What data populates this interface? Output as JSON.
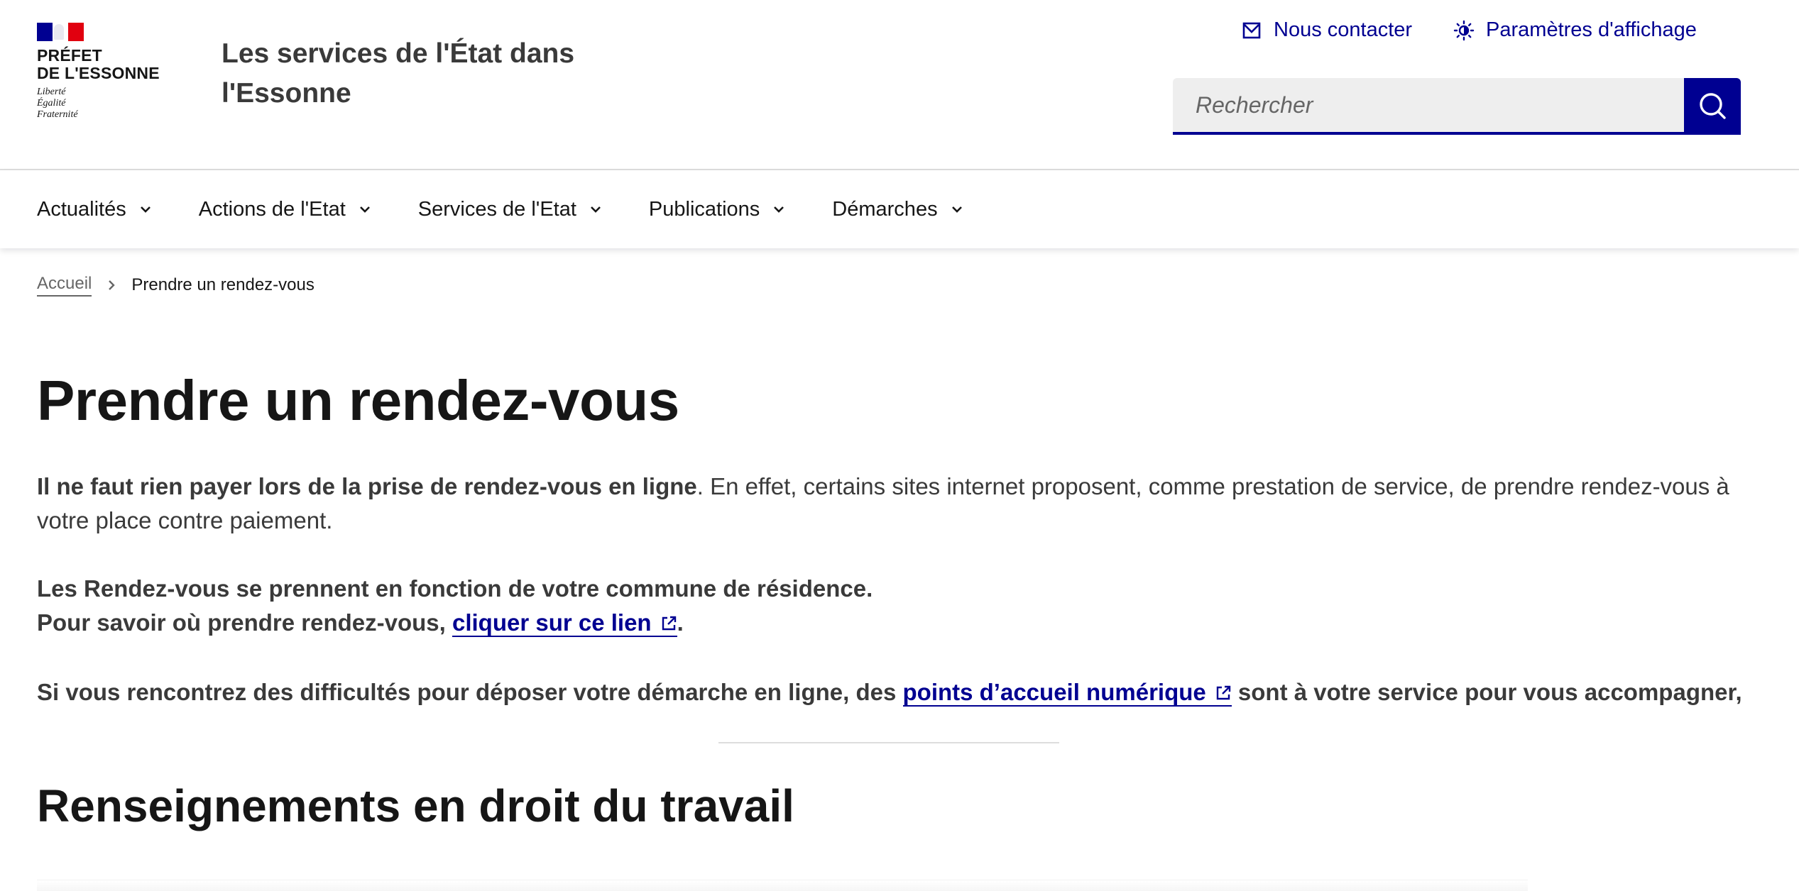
{
  "header": {
    "logo": {
      "name_line1": "PRÉFET",
      "name_line2": "DE L'ESSONNE",
      "motto": [
        "Liberté",
        "Égalité",
        "Fraternité"
      ],
      "flag_colors": {
        "blue": "#000091",
        "white": "#ffffff",
        "red": "#e1000f"
      }
    },
    "site_title": "Les services de l'État dans l'Essonne",
    "tools": {
      "contact_label": "Nous contacter",
      "contact_icon": "mail-icon",
      "display_label": "Paramètres d'affichage",
      "display_icon": "sun-contrast-icon"
    },
    "search": {
      "placeholder": "Rechercher",
      "value": "",
      "button_icon": "search-icon",
      "button_label": "Rechercher"
    }
  },
  "nav": {
    "items": [
      {
        "label": "Actualités"
      },
      {
        "label": "Actions de l'Etat"
      },
      {
        "label": "Services de l'Etat"
      },
      {
        "label": "Publications"
      },
      {
        "label": "Démarches"
      }
    ]
  },
  "breadcrumb": {
    "home": "Accueil",
    "current": "Prendre un rendez-vous"
  },
  "main": {
    "title": "Prendre un rendez-vous",
    "p1_bold": "Il ne faut rien payer lors de la prise de rendez-vous en ligne",
    "p1_rest": ". En effet, certains sites internet proposent, comme prestation de service, de prendre rendez-vous à votre place contre paiement.",
    "p2_line1": "Les Rendez-vous se prennent en fonction de votre commune de résidence.",
    "p2_line2_prefix": "Pour savoir où prendre rendez-vous, ",
    "p2_link": "cliquer sur ce lien",
    "p2_suffix": ".",
    "p3_prefix": "Si vous rencontrez des difficultés pour déposer votre démarche en ligne, des ",
    "p3_link": "points d’accueil numérique",
    "p3_suffix": " sont à votre service pour vous accompagner,",
    "section_title": "Renseignements en droit du travail"
  },
  "colors": {
    "primary": "#000091",
    "text": "#3a3a3a",
    "heading": "#161616",
    "muted": "#666666",
    "search_bg": "#eeeeee"
  }
}
